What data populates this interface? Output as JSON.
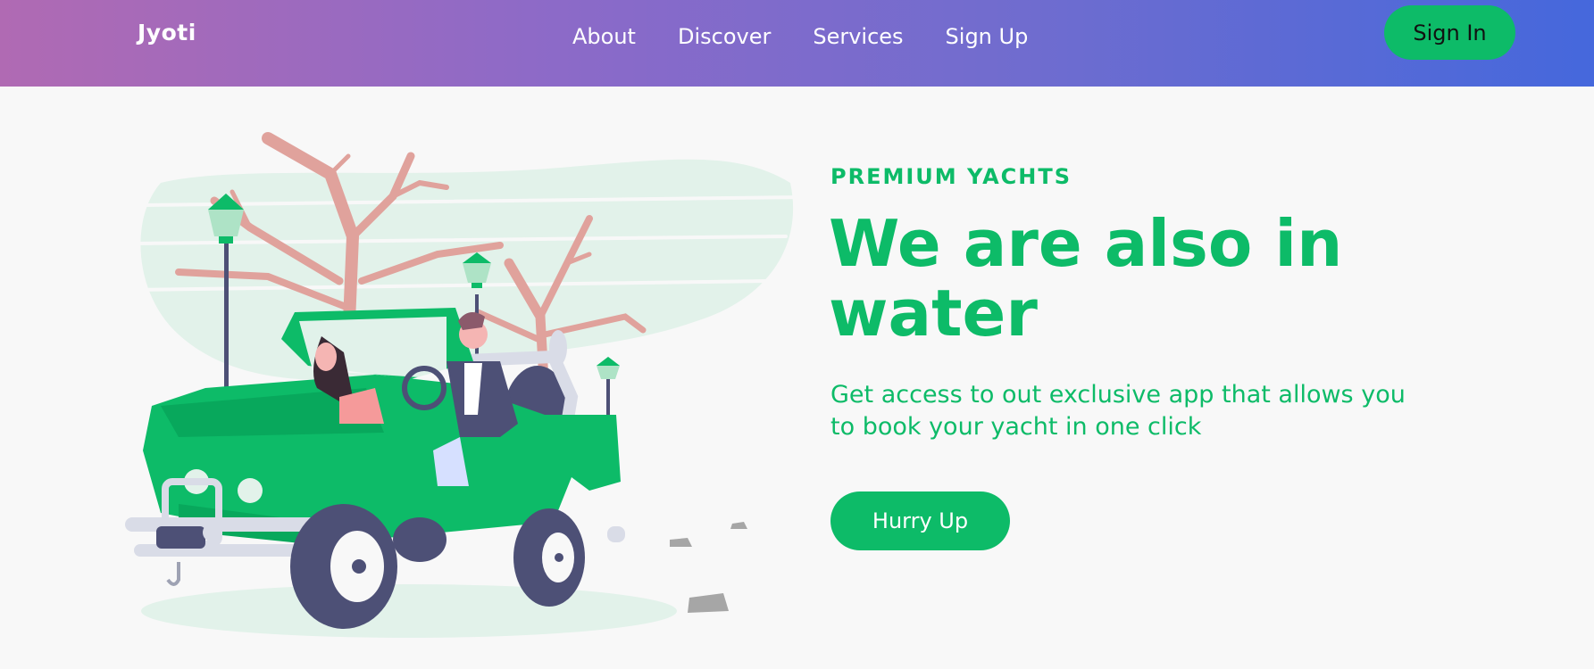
{
  "header": {
    "brand": "Jyoti",
    "nav": [
      {
        "label": "About"
      },
      {
        "label": "Discover"
      },
      {
        "label": "Services"
      },
      {
        "label": "Sign Up"
      }
    ],
    "signin_label": "Sign In"
  },
  "hero": {
    "eyebrow": "PREMIUM YACHTS",
    "headline": "We are also in water",
    "subtext": "Get access to out exclusive app that allows you to book your yacht in one click",
    "cta_label": "Hurry Up",
    "illustration": "people-driving-jeep-illustration"
  },
  "colors": {
    "accent": "#0dbb68",
    "gradient_start": "#b06ab3",
    "gradient_end": "#4568dc",
    "background": "#f8f8f8"
  }
}
